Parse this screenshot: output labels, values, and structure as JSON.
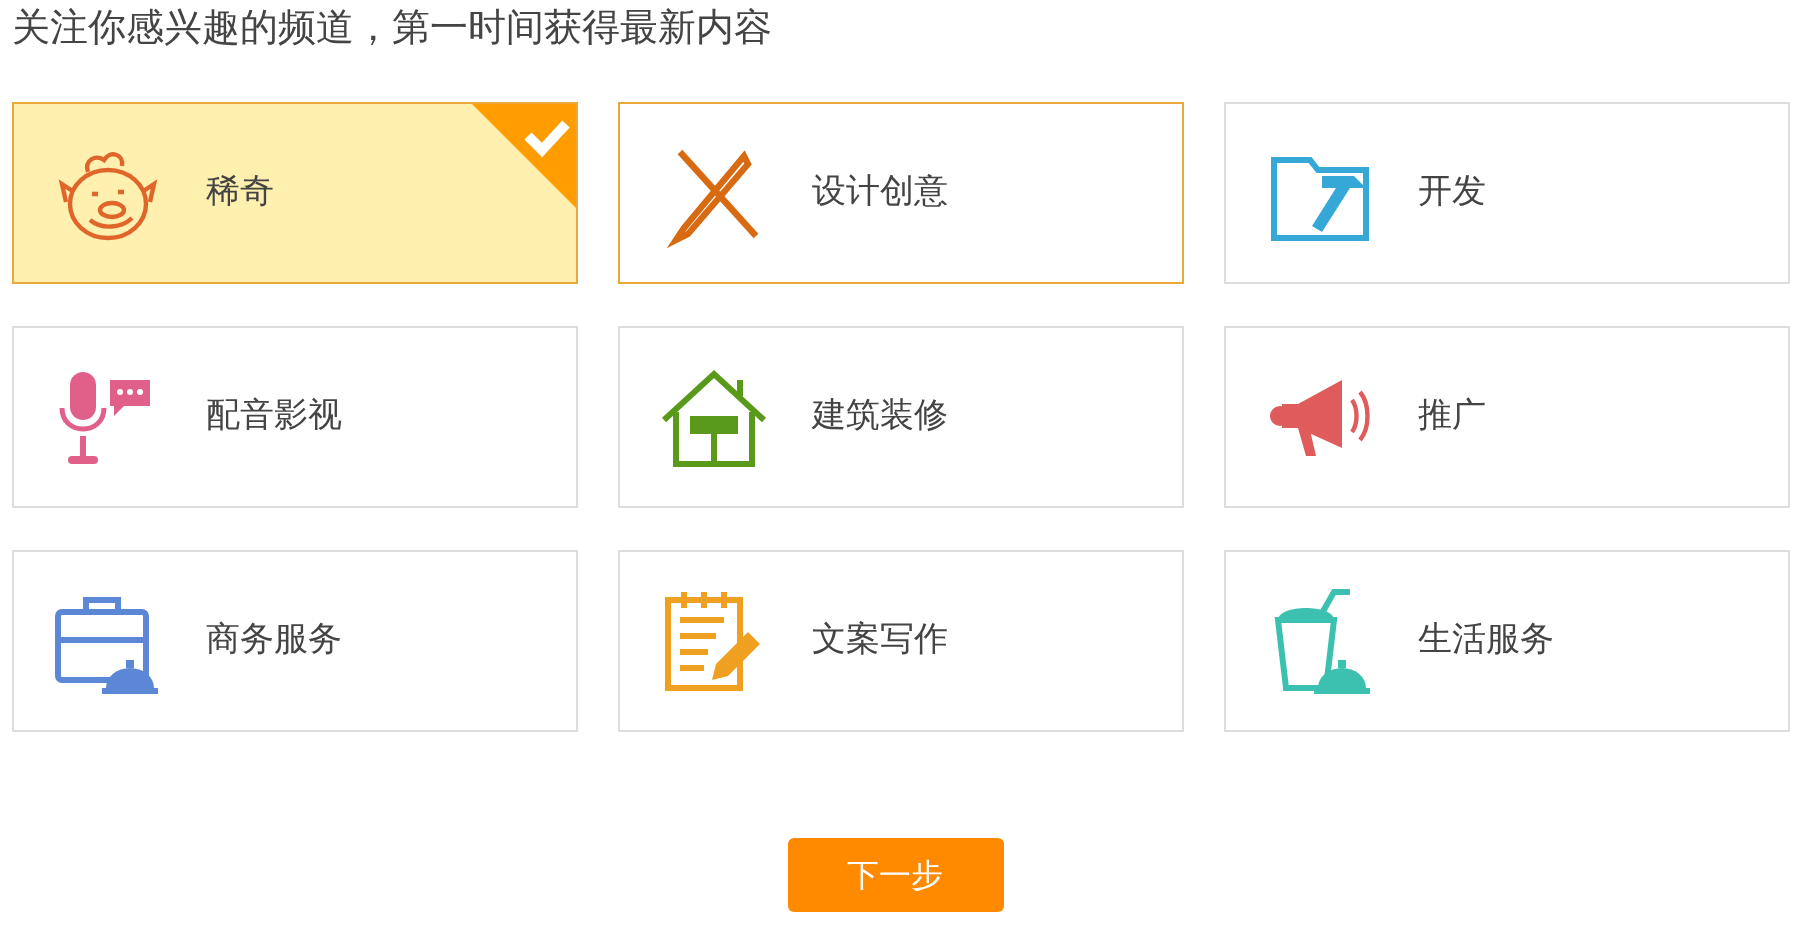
{
  "heading": "关注你感兴趣的频道，第一时间获得最新内容",
  "channels": [
    {
      "label": "稀奇",
      "selected": true,
      "hovered": false
    },
    {
      "label": "设计创意",
      "selected": false,
      "hovered": true
    },
    {
      "label": "开发",
      "selected": false,
      "hovered": false
    },
    {
      "label": "配音影视",
      "selected": false,
      "hovered": false
    },
    {
      "label": "建筑装修",
      "selected": false,
      "hovered": false
    },
    {
      "label": "推广",
      "selected": false,
      "hovered": false
    },
    {
      "label": "商务服务",
      "selected": false,
      "hovered": false
    },
    {
      "label": "文案写作",
      "selected": false,
      "hovered": false
    },
    {
      "label": "生活服务",
      "selected": false,
      "hovered": false
    }
  ],
  "next_button": "下一步"
}
